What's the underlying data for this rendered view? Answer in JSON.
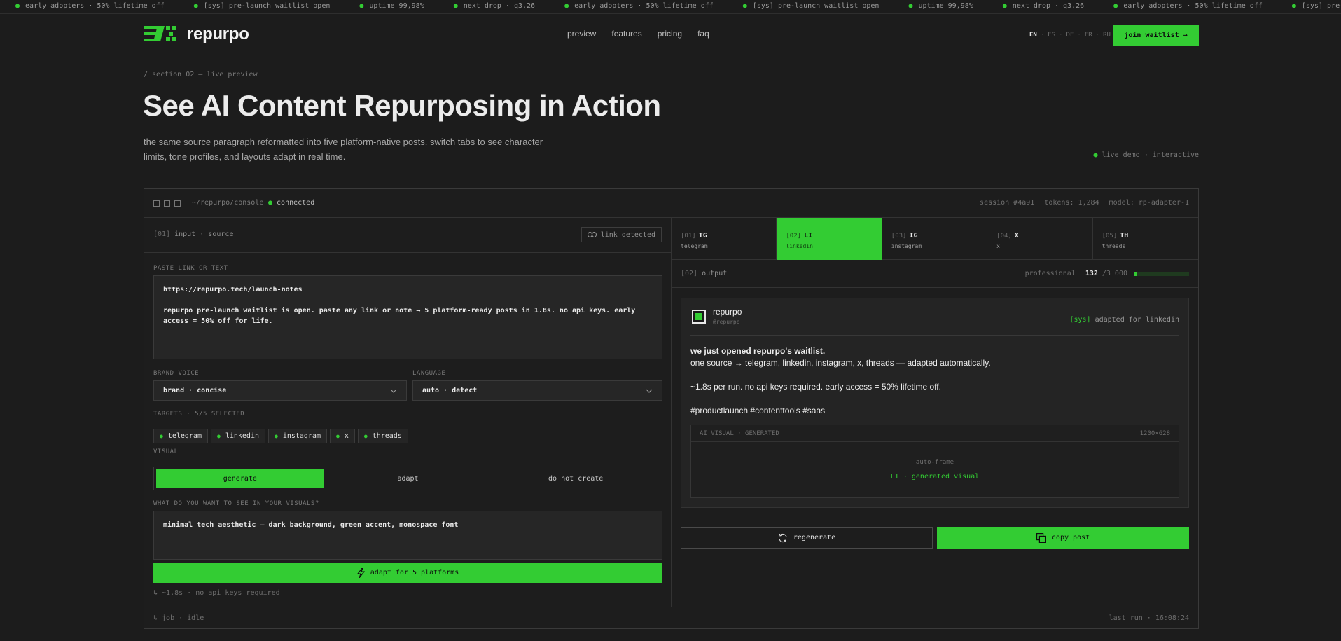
{
  "ticker": [
    "early adopters · 50% lifetime off",
    "[sys] pre-launch waitlist open",
    "uptime 99,98%",
    "next drop · q3.26",
    "early adopters · 50% lifetime off",
    "[sys] pre-launch waitlist open",
    "uptime 99,98%",
    "next drop · q3.26",
    "early adopters · 50% lifetime off",
    "[sys] pre-launch waitlist open"
  ],
  "header": {
    "brand": "repurpo",
    "nav": [
      "preview",
      "features",
      "pricing",
      "faq"
    ],
    "languages": [
      "EN",
      "ES",
      "DE",
      "FR",
      "RU"
    ],
    "active_language": "EN",
    "cta": "join waitlist"
  },
  "hero": {
    "section_label": "/ section 02 — live preview",
    "title": "See AI Content Repurposing in Action",
    "subtitle": "the same source paragraph reformatted into five platform-native posts. switch tabs to see character limits, tone profiles, and layouts adapt in real time.",
    "live_badge": "live demo · interactive"
  },
  "console": {
    "path": "~/repurpo/console",
    "status": "connected",
    "session": "session #4a91",
    "tokens": "tokens: 1,284",
    "model": "model: rp-adapter-1",
    "input": {
      "index": "[01]",
      "label": "input · source",
      "link_detected": "link detected",
      "paste_label": "PASTE LINK OR TEXT",
      "source_url": "https://repurpo.tech/launch-notes",
      "source_text": "repurpo pre-launch waitlist is open. paste any link or note → 5 platform-ready posts in 1.8s. no api keys. early access = 50% off for life.",
      "brand_voice_label": "BRAND VOICE",
      "brand_voice_value": "brand · concise",
      "language_label": "LANGUAGE",
      "language_value": "auto · detect",
      "targets_label": "TARGETS · 5/5 SELECTED",
      "targets": [
        "telegram",
        "linkedin",
        "instagram",
        "x",
        "threads"
      ],
      "visual_label": "VISUAL",
      "visual_options": [
        "generate",
        "adapt",
        "do not create"
      ],
      "visual_selected": "generate",
      "visual_prompt_label": "WHAT DO YOU WANT TO SEE IN YOUR VISUALS?",
      "visual_prompt_value": "minimal tech aesthetic — dark background, green accent, monospace font",
      "adapt_button": "adapt for 5 platforms",
      "adapt_note": "↳ ~1.8s · no api keys required"
    },
    "tabs": [
      {
        "num": "[01]",
        "code": "TG",
        "name": "telegram",
        "active": false
      },
      {
        "num": "[02]",
        "code": "LI",
        "name": "linkedin",
        "active": true
      },
      {
        "num": "[03]",
        "code": "IG",
        "name": "instagram",
        "active": false
      },
      {
        "num": "[04]",
        "code": "X",
        "name": "x",
        "active": false
      },
      {
        "num": "[05]",
        "code": "TH",
        "name": "threads",
        "active": false
      }
    ],
    "output": {
      "index": "[02]",
      "label": "output",
      "tone": "professional",
      "char_count": "132",
      "char_limit": "/3 000",
      "fill_fraction": 0.044,
      "post": {
        "name": "repurpo",
        "handle": "@repurpo",
        "adapted_tag": "[sys]",
        "adapted_text": "adapted for linkedin",
        "headline": "we just opened repurpo's waitlist.",
        "line2": "one source → telegram, linkedin, instagram, x, threads — adapted automatically.",
        "line3": "~1.8s per run. no api keys required. early access = 50% lifetime off.",
        "hashtags": "#productlaunch #contenttools #saas"
      },
      "visual": {
        "label": "AI VISUAL · GENERATED",
        "size": "1200×628",
        "frame": "auto-frame",
        "generated": "LI · generated visual"
      },
      "regenerate": "regenerate",
      "copy": "copy post"
    },
    "footer": {
      "job": "↳ job · idle",
      "last_run": "last run · 16:08:24"
    }
  },
  "colors": {
    "accent": "#33cc33",
    "background": "#1c1c1c",
    "panel": "#262626"
  }
}
